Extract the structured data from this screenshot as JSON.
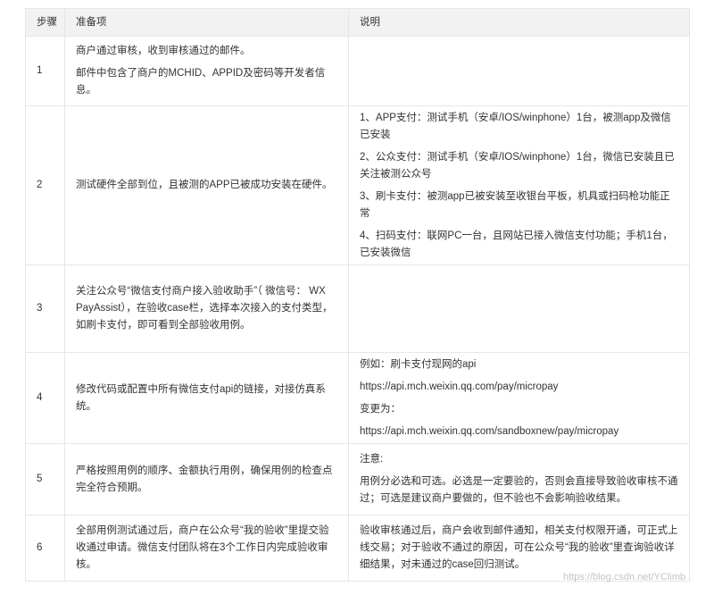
{
  "headers": {
    "step": "步骤",
    "prep": "准备项",
    "note": "说明"
  },
  "rows": [
    {
      "step": "1",
      "prep": [
        "商户通过审核，收到审核通过的邮件。",
        "邮件中包含了商户的MCHID、APPID及密码等开发者信息。"
      ],
      "note": []
    },
    {
      "step": "2",
      "prep": [
        "测试硬件全部到位，且被测的APP已被成功安装在硬件。"
      ],
      "note": [
        "1、APP支付：测试手机（安卓/IOS/winphone）1台，被测app及微信已安装",
        "2、公众支付：测试手机（安卓/IOS/winphone）1台，微信已安装且已关注被测公众号",
        "3、刷卡支付：被测app已被安装至收银台平板，机具或扫码枪功能正常",
        "4、扫码支付：联网PC一台，且网站已接入微信支付功能；手机1台，已安装微信"
      ]
    },
    {
      "step": "3",
      "prep": [
        "关注公众号“微信支付商户接入验收助手”（ 微信号： WX PayAssist），在验收case栏，选择本次接入的支付类型，如刷卡支付，即可看到全部验收用例。"
      ],
      "note": []
    },
    {
      "step": "4",
      "prep": [
        "修改代码或配置中所有微信支付api的链接，对接仿真系统。"
      ],
      "note": [
        "例如：刷卡支付现网的api",
        "https://api.mch.weixin.qq.com/pay/micropay",
        "变更为：",
        "https://api.mch.weixin.qq.com/sandboxnew/pay/micropay"
      ]
    },
    {
      "step": "5",
      "prep": [
        "严格按照用例的顺序、金额执行用例，确保用例的检查点完全符合预期。"
      ],
      "note": [
        "注意:",
        "用例分必选和可选。必选是一定要验的，否则会直接导致验收审核不通过；可选是建议商户要做的，但不验也不会影响验收结果。"
      ]
    },
    {
      "step": "6",
      "prep": [
        "全部用例测试通过后，商户在公众号“我的验收”里提交验收通过申请。微信支付团队将在3个工作日内完成验收审核。"
      ],
      "note": [
        "验收审核通过后，商户会收到邮件通知，相关支付权限开通，可正式上线交易；对于验收不通过的原因，可在公众号“我的验收”里查询验收详细结果，对未通过的case回归测试。"
      ]
    }
  ],
  "watermark": "https://blog.csdn.net/YClimb"
}
